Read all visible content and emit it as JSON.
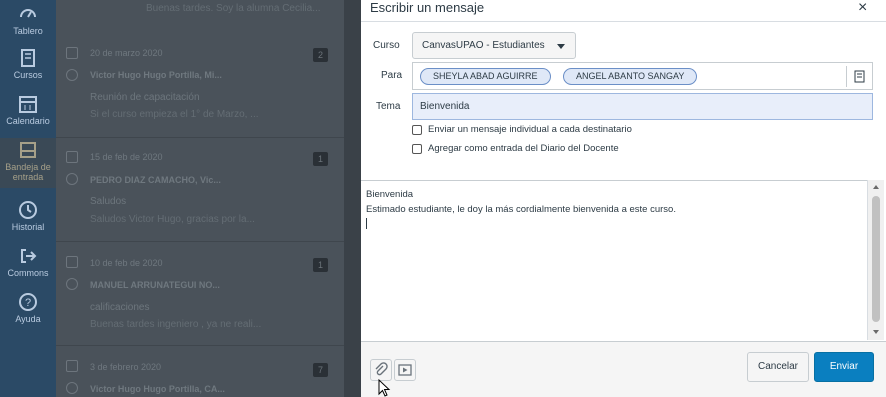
{
  "nav": {
    "items": [
      {
        "label": "Tablero",
        "icon": "dashboard-icon"
      },
      {
        "label": "Cursos",
        "icon": "courses-icon"
      },
      {
        "label": "Calendario",
        "icon": "calendar-icon"
      },
      {
        "label": "Bandeja de entrada",
        "icon": "inbox-icon"
      },
      {
        "label": "Historial",
        "icon": "history-icon"
      },
      {
        "label": "Commons",
        "icon": "commons-icon"
      },
      {
        "label": "Ayuda",
        "icon": "help-icon"
      }
    ]
  },
  "conversations": {
    "top_preview": "Buenas tardes. Soy la alumna Cecilia...",
    "items": [
      {
        "date": "20 de marzo 2020",
        "sender": "Victor Hugo Hugo Portilla, Mi...",
        "subject": "Reunión de capacitación",
        "preview": "Si el curso empieza el 1° de Marzo, ...",
        "count": "2"
      },
      {
        "date": "15 de feb de 2020",
        "sender": "PEDRO DIAZ CAMACHO, Vic...",
        "subject": "Saludos",
        "preview": "Saludos Victor Hugo, gracias por la...",
        "count": "1"
      },
      {
        "date": "10 de feb de 2020",
        "sender": "MANUEL ARRUNATEGUI NO...",
        "subject": "calificaciones",
        "preview": "Buenas tardes ingeniero , ya ne reali...",
        "count": "1"
      },
      {
        "date": "3 de febrero 2020",
        "sender": "Victor Hugo Hugo Portilla, CA...",
        "subject": "",
        "preview": "",
        "count": "7"
      }
    ]
  },
  "modal": {
    "title": "Escribir un mensaje",
    "close_label": "×",
    "course_label": "Curso",
    "course_value": "CanvasUPAO - Estudiantes",
    "to_label": "Para",
    "recipients": [
      "SHEYLA ABAD AGUIRRE",
      "ANGEL ABANTO SANGAY"
    ],
    "subject_label": "Tema",
    "subject_value": "Bienvenida",
    "checkbox_individual": "Enviar un mensaje individual a cada destinatario",
    "checkbox_journal": "Agregar como entrada del Diario del Docente",
    "body_line1": "Bienvenida",
    "body_line2": "Estimado estudiante, le doy la más cordialmente bienvenida a este curso.",
    "cancel_label": "Cancelar",
    "send_label": "Enviar"
  },
  "colors": {
    "primary": "#0a7fc0",
    "nav_bg": "#2b4a66",
    "token_bg": "#dfe8f7"
  }
}
